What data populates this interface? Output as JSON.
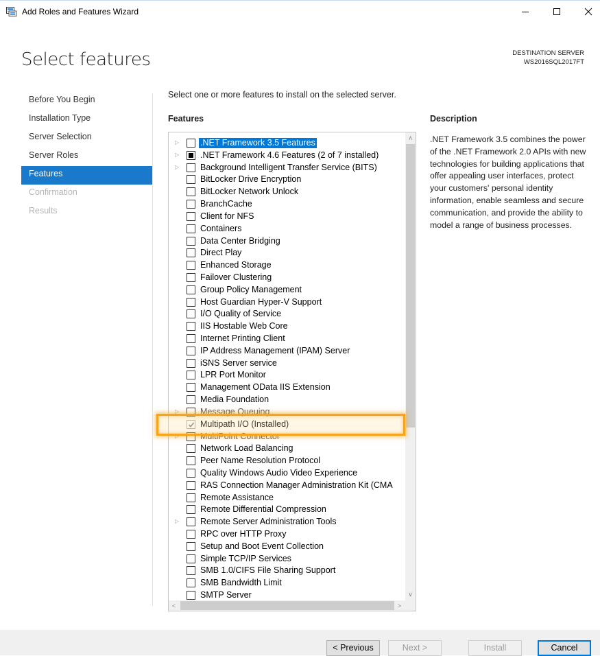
{
  "window": {
    "title": "Add Roles and Features Wizard",
    "icons": [
      "server-manager-icon",
      "minimize-icon",
      "maximize-icon",
      "close-icon"
    ]
  },
  "page": {
    "title": "Select features",
    "destination_label": "DESTINATION SERVER",
    "destination_server": "WS2016SQL2017FT"
  },
  "nav": {
    "items": [
      {
        "label": "Before You Begin",
        "state": "normal"
      },
      {
        "label": "Installation Type",
        "state": "normal"
      },
      {
        "label": "Server Selection",
        "state": "normal"
      },
      {
        "label": "Server Roles",
        "state": "normal"
      },
      {
        "label": "Features",
        "state": "active"
      },
      {
        "label": "Confirmation",
        "state": "disabled"
      },
      {
        "label": "Results",
        "state": "disabled"
      }
    ]
  },
  "main": {
    "instruction": "Select one or more features to install on the selected server.",
    "features_heading": "Features",
    "description_heading": "Description",
    "description": ".NET Framework 3.5 combines the power of the .NET Framework 2.0 APIs with new technologies for building applications that offer appealing user interfaces, protect your customers' personal identity information, enable seamless and secure communication, and provide the ability to model a range of business processes."
  },
  "features": [
    {
      "label": ".NET Framework 3.5 Features",
      "expandable": true,
      "state": "unchecked",
      "selected": true
    },
    {
      "label": ".NET Framework 4.6 Features (2 of 7 installed)",
      "expandable": true,
      "state": "partial"
    },
    {
      "label": "Background Intelligent Transfer Service (BITS)",
      "expandable": true,
      "state": "unchecked"
    },
    {
      "label": "BitLocker Drive Encryption",
      "expandable": false,
      "state": "unchecked"
    },
    {
      "label": "BitLocker Network Unlock",
      "expandable": false,
      "state": "unchecked"
    },
    {
      "label": "BranchCache",
      "expandable": false,
      "state": "unchecked"
    },
    {
      "label": "Client for NFS",
      "expandable": false,
      "state": "unchecked"
    },
    {
      "label": "Containers",
      "expandable": false,
      "state": "unchecked"
    },
    {
      "label": "Data Center Bridging",
      "expandable": false,
      "state": "unchecked"
    },
    {
      "label": "Direct Play",
      "expandable": false,
      "state": "unchecked"
    },
    {
      "label": "Enhanced Storage",
      "expandable": false,
      "state": "unchecked"
    },
    {
      "label": "Failover Clustering",
      "expandable": false,
      "state": "unchecked"
    },
    {
      "label": "Group Policy Management",
      "expandable": false,
      "state": "unchecked"
    },
    {
      "label": "Host Guardian Hyper-V Support",
      "expandable": false,
      "state": "unchecked"
    },
    {
      "label": "I/O Quality of Service",
      "expandable": false,
      "state": "unchecked"
    },
    {
      "label": "IIS Hostable Web Core",
      "expandable": false,
      "state": "unchecked"
    },
    {
      "label": "Internet Printing Client",
      "expandable": false,
      "state": "unchecked"
    },
    {
      "label": "IP Address Management (IPAM) Server",
      "expandable": false,
      "state": "unchecked"
    },
    {
      "label": "iSNS Server service",
      "expandable": false,
      "state": "unchecked"
    },
    {
      "label": "LPR Port Monitor",
      "expandable": false,
      "state": "unchecked"
    },
    {
      "label": "Management OData IIS Extension",
      "expandable": false,
      "state": "unchecked"
    },
    {
      "label": "Media Foundation",
      "expandable": false,
      "state": "unchecked"
    },
    {
      "label": "Message Queuing",
      "expandable": true,
      "state": "unchecked",
      "obscured": true
    },
    {
      "label": "Multipath I/O (Installed)",
      "expandable": false,
      "state": "checked-disabled"
    },
    {
      "label": "MultiPoint Connector",
      "expandable": true,
      "state": "unchecked",
      "obscured": true
    },
    {
      "label": "Network Load Balancing",
      "expandable": false,
      "state": "unchecked"
    },
    {
      "label": "Peer Name Resolution Protocol",
      "expandable": false,
      "state": "unchecked"
    },
    {
      "label": "Quality Windows Audio Video Experience",
      "expandable": false,
      "state": "unchecked"
    },
    {
      "label": "RAS Connection Manager Administration Kit (CMA",
      "expandable": false,
      "state": "unchecked"
    },
    {
      "label": "Remote Assistance",
      "expandable": false,
      "state": "unchecked"
    },
    {
      "label": "Remote Differential Compression",
      "expandable": false,
      "state": "unchecked"
    },
    {
      "label": "Remote Server Administration Tools",
      "expandable": true,
      "state": "unchecked"
    },
    {
      "label": "RPC over HTTP Proxy",
      "expandable": false,
      "state": "unchecked"
    },
    {
      "label": "Setup and Boot Event Collection",
      "expandable": false,
      "state": "unchecked"
    },
    {
      "label": "Simple TCP/IP Services",
      "expandable": false,
      "state": "unchecked"
    },
    {
      "label": "SMB 1.0/CIFS File Sharing Support",
      "expandable": false,
      "state": "unchecked"
    },
    {
      "label": "SMB Bandwidth Limit",
      "expandable": false,
      "state": "unchecked"
    },
    {
      "label": "SMTP Server",
      "expandable": false,
      "state": "unchecked",
      "partially_visible": true
    }
  ],
  "buttons": {
    "previous": "< Previous",
    "next": "Next >",
    "install": "Install",
    "cancel": "Cancel"
  },
  "colors": {
    "accent": "#1979ca",
    "selection": "#0078d7",
    "highlight": "#f7a41d"
  }
}
